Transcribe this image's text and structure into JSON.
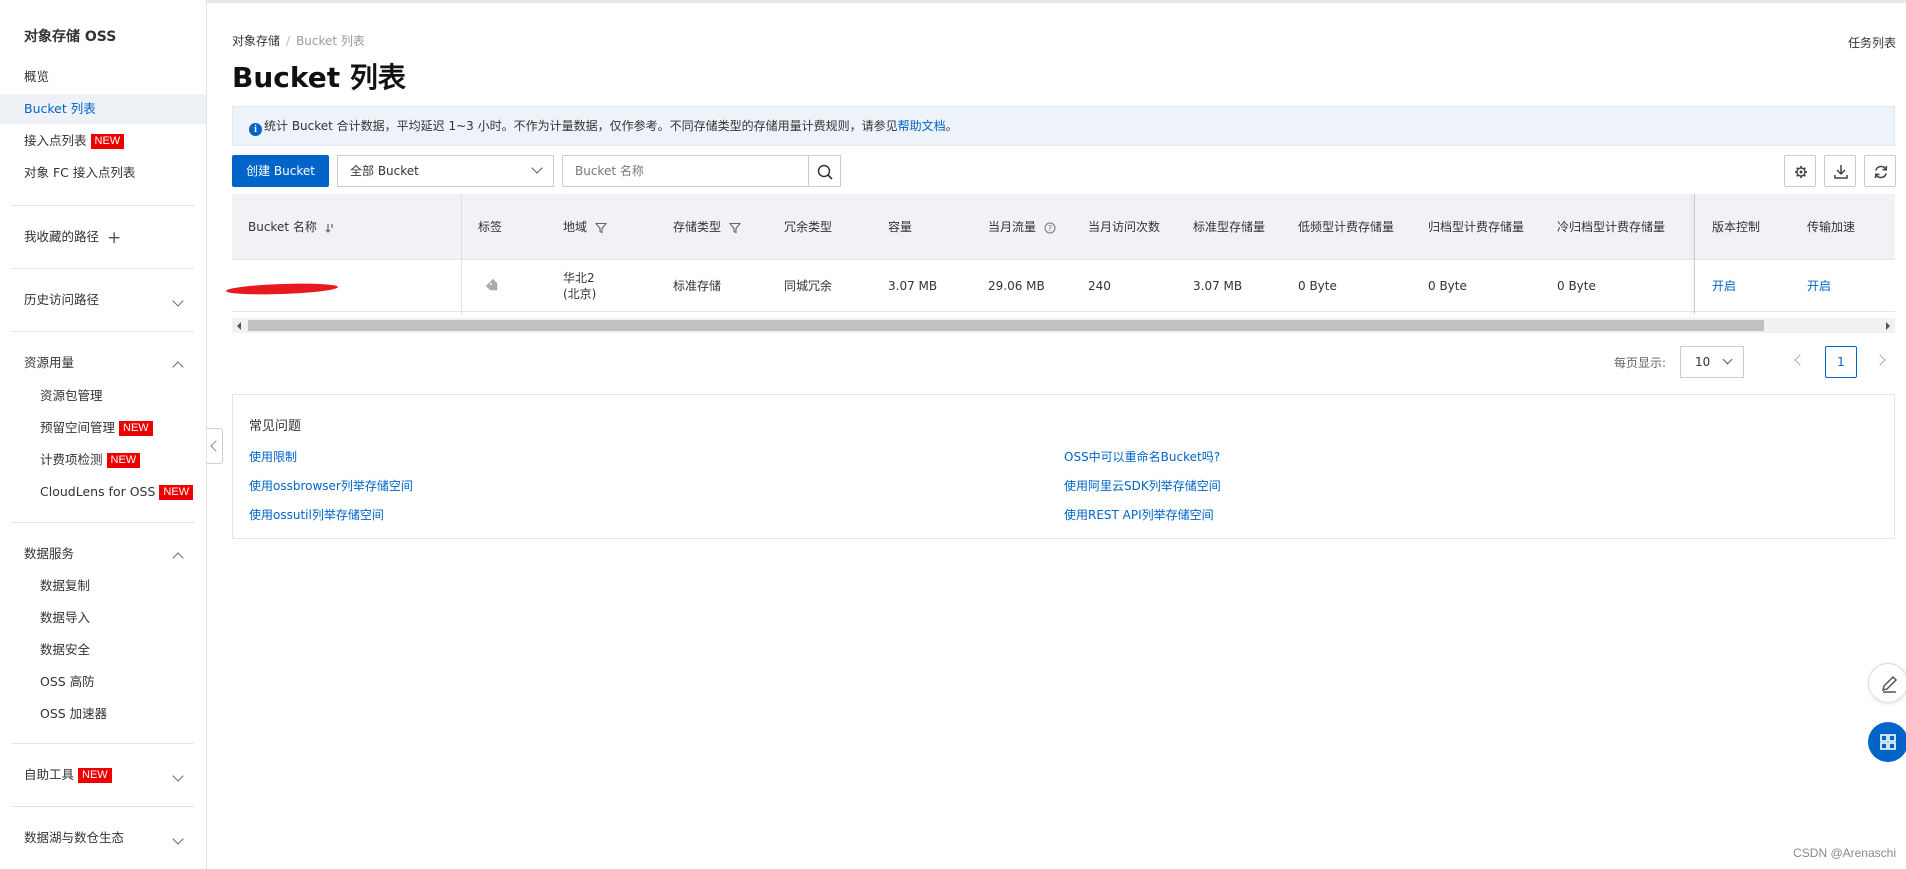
{
  "sidebar": {
    "title": "对象存储 OSS",
    "overview": "概览",
    "bucket_list": "Bucket 列表",
    "access_points": "接入点列表",
    "fc_access_points": "对象 FC 接入点列表",
    "favorites": "我收藏的路径",
    "history": "历史访问路径",
    "resource_usage": "资源用量",
    "resource_pack": "资源包管理",
    "reserved_space": "预留空间管理",
    "billing_check": "计费项检测",
    "cloudlens": "CloudLens for OSS",
    "data_services": "数据服务",
    "data_replication": "数据复制",
    "data_import": "数据导入",
    "data_security": "数据安全",
    "oss_ddos": "OSS 高防",
    "oss_accelerator": "OSS 加速器",
    "self_service": "自助工具",
    "data_lake": "数据湖与数仓生态",
    "new_badge": "NEW"
  },
  "breadcrumb": {
    "root": "对象存储",
    "current": "Bucket 列表"
  },
  "header": {
    "title": "Bucket 列表",
    "task_list": "任务列表"
  },
  "notice": {
    "text": "统计 Bucket 合计数据，平均延迟 1~3 小时。不作为计量数据，仅作参考。不同存储类型的存储用量计费规则，请参见",
    "link": "帮助文档",
    "tail": "。"
  },
  "toolbar": {
    "create_label": "创建 Bucket",
    "filter_value": "全部 Bucket",
    "search_placeholder": "Bucket 名称"
  },
  "table": {
    "headers": {
      "name": "Bucket 名称",
      "tags": "标签",
      "region": "地域",
      "storage_type": "存储类型",
      "redundancy": "冗余类型",
      "capacity": "容量",
      "monthly_traffic": "当月流量",
      "monthly_visits": "当月访问次数",
      "standard_storage": "标准型存储量",
      "ia_storage": "低频型计费存储量",
      "archive_storage": "归档型计费存储量",
      "cold_archive_storage": "冷归档型计费存储量",
      "versioning": "版本控制",
      "transfer_accel": "传输加速"
    },
    "rows": [
      {
        "region_line1": "华北2",
        "region_line2": "(北京)",
        "storage_type": "标准存储",
        "redundancy": "同城冗余",
        "capacity": "3.07 MB",
        "monthly_traffic": "29.06 MB",
        "monthly_visits": "240",
        "standard_storage": "3.07 MB",
        "ia_storage": "0 Byte",
        "archive_storage": "0 Byte",
        "cold_archive_storage": "0 Byte",
        "versioning": "开启",
        "transfer_accel": "开启"
      }
    ]
  },
  "pagination": {
    "per_page_label": "每页显示:",
    "per_page": "10",
    "current_page": "1"
  },
  "faq": {
    "title": "常见问题",
    "links": [
      "使用限制",
      "使用ossbrowser列举存储空间",
      "使用ossutil列举存储空间",
      "OSS中可以重命名Bucket吗?",
      "使用阿里云SDK列举存储空间",
      "使用REST API列举存储空间"
    ]
  },
  "watermark": "CSDN @Arenaschi",
  "colors": {
    "primary": "#0064c8",
    "new_badge": "#e00000",
    "accent": "#ff6a00"
  }
}
